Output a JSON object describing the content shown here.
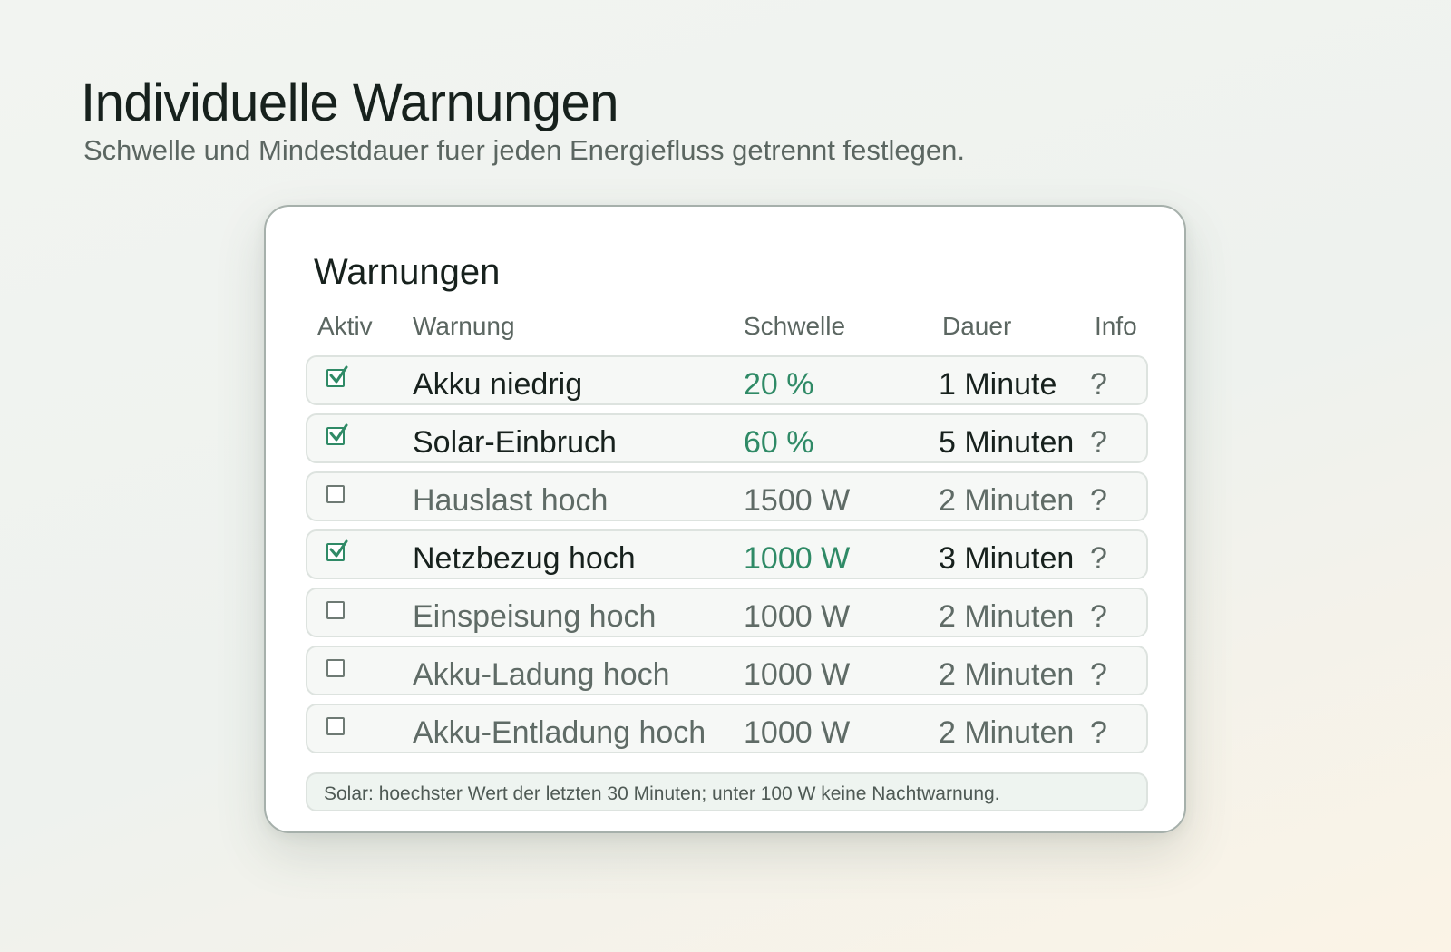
{
  "page": {
    "title": "Individuelle Warnungen",
    "subtitle": "Schwelle und Mindestdauer fuer jeden Energiefluss getrennt festlegen."
  },
  "card": {
    "title": "Warnungen",
    "columns": {
      "aktiv": "Aktiv",
      "warnung": "Warnung",
      "schwelle": "Schwelle",
      "dauer": "Dauer",
      "info": "Info"
    },
    "rows": [
      {
        "active": true,
        "name": "Akku niedrig",
        "threshold": "20 %",
        "duration": "1 Minute",
        "info": "?"
      },
      {
        "active": true,
        "name": "Solar-Einbruch",
        "threshold": "60 %",
        "duration": "5 Minuten",
        "info": "?"
      },
      {
        "active": false,
        "name": "Hauslast hoch",
        "threshold": "1500 W",
        "duration": "2 Minuten",
        "info": "?"
      },
      {
        "active": true,
        "name": "Netzbezug hoch",
        "threshold": "1000 W",
        "duration": "3 Minuten",
        "info": "?"
      },
      {
        "active": false,
        "name": "Einspeisung hoch",
        "threshold": "1000 W",
        "duration": "2 Minuten",
        "info": "?"
      },
      {
        "active": false,
        "name": "Akku-Ladung hoch",
        "threshold": "1000 W",
        "duration": "2 Minuten",
        "info": "?"
      },
      {
        "active": false,
        "name": "Akku-Entladung hoch",
        "threshold": "1000 W",
        "duration": "2 Minuten",
        "info": "?"
      }
    ],
    "note": "Solar: hoechster Wert der letzten 30 Minuten; unter 100 W keine Nachtwarnung."
  },
  "colors": {
    "accent": "#2f8a66",
    "text_primary": "#17211d",
    "text_muted": "#5f6b66",
    "row_border": "#dde3df"
  },
  "icons": {
    "checked": "checkbox-checked-icon",
    "unchecked": "checkbox-unchecked-icon",
    "info": "question-mark"
  }
}
